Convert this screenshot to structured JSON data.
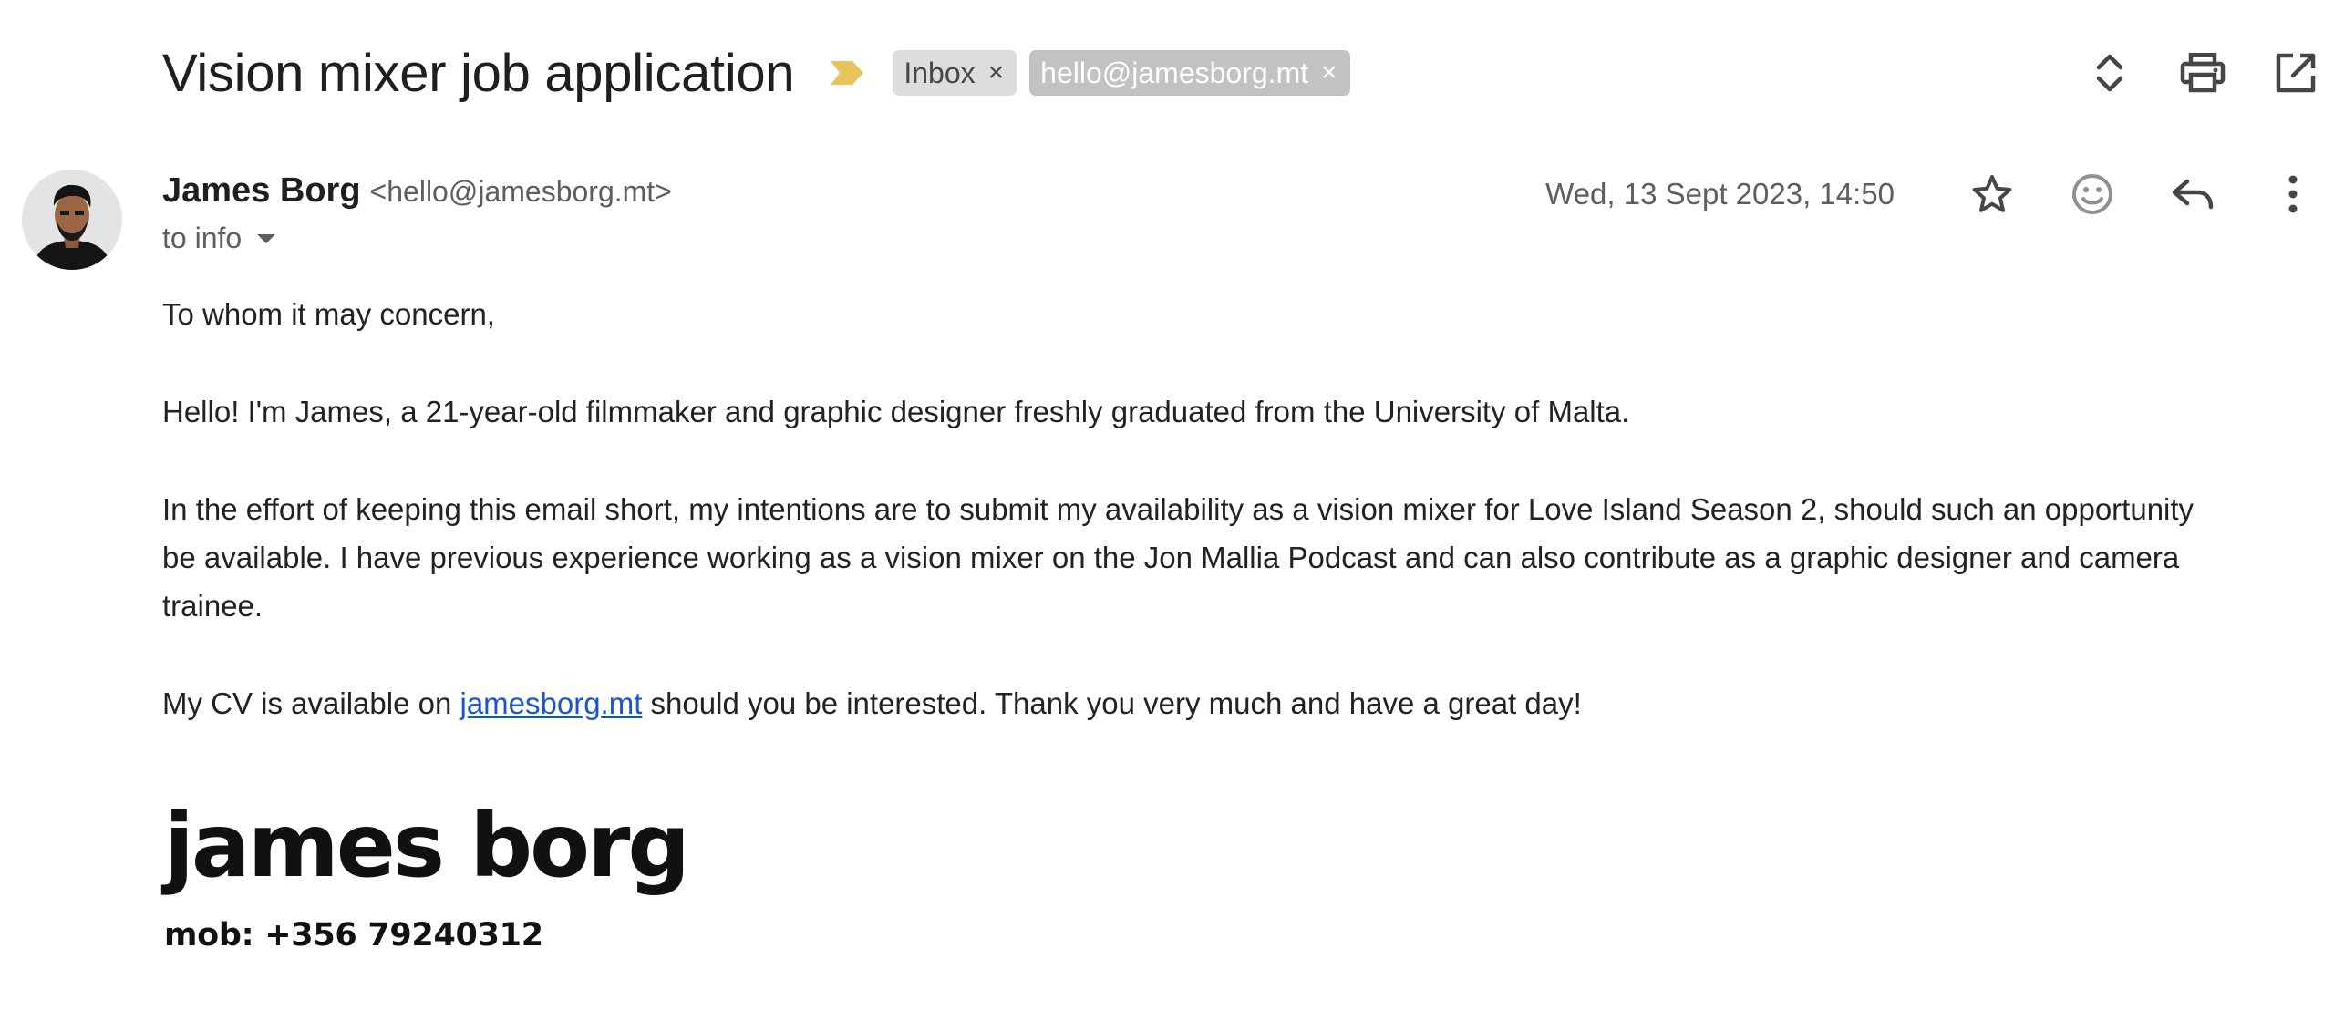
{
  "subject": {
    "title": "Vision mixer job application",
    "importance_icon": "importance-marker-icon",
    "importance_color": "#e8c25a",
    "labels": [
      {
        "text": "Inbox",
        "bg": "#dddddd"
      },
      {
        "text": "hello@jamesborg.mt",
        "bg": "#c2c2c2"
      }
    ]
  },
  "header_actions": {
    "icons": [
      "expand-collapse-icon",
      "print-icon",
      "open-in-new-window-icon"
    ]
  },
  "message": {
    "sender_name": "James Borg",
    "sender_email": "<hello@jamesborg.mt>",
    "recipient": "to info",
    "date": "Wed, 13 Sept 2023, 14:50",
    "action_icons": [
      "star-icon",
      "emoji-reaction-icon",
      "reply-icon",
      "more-options-icon"
    ],
    "body": {
      "greeting": "To whom it may concern,",
      "intro": "Hello! I'm James, a 21-year-old filmmaker and graphic designer freshly graduated from the University of Malta.",
      "paragraph": "In the effort of keeping this email short, my intentions are to submit my availability as a vision mixer for Love Island Season 2, should such an opportunity be available. I have previous experience working as a vision mixer on the Jon Mallia Podcast and can also contribute as a graphic designer and camera trainee.",
      "cv_before": "My CV is available on ",
      "cv_link": "jamesborg.mt",
      "cv_after": " should you be interested. Thank you very much and have a great day!"
    },
    "signature": {
      "name": "james borg",
      "mobile": "mob: +356 79240312"
    },
    "link_color": "#1a55d0"
  }
}
